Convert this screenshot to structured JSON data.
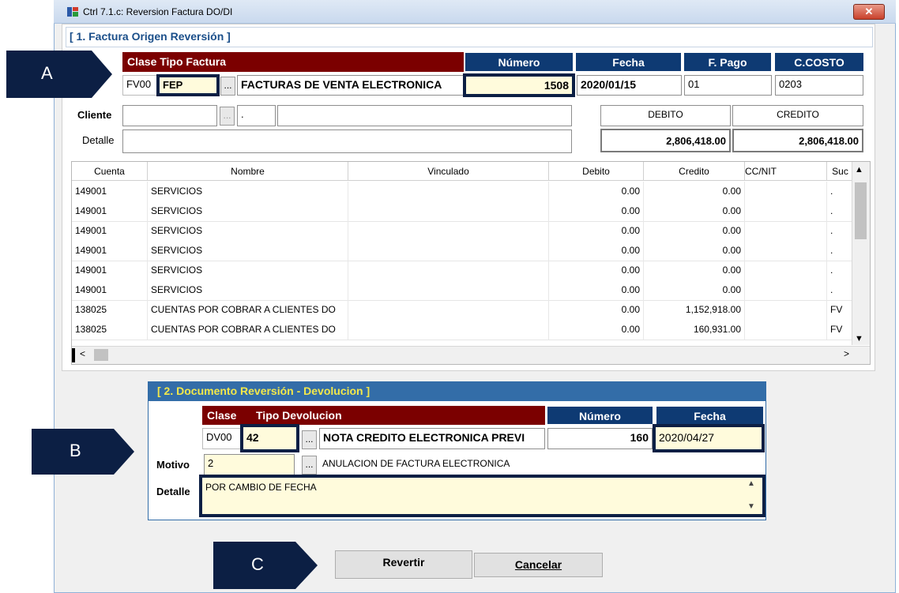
{
  "window": {
    "title": "Ctrl 7.1.c:  Reversion Factura DO/DI",
    "close_label": "✕"
  },
  "section1": {
    "title": "[ 1. Factura Origen Reversión ]",
    "headers": {
      "clase_tipo": "Clase  Tipo Factura",
      "numero": "Número",
      "fecha": "Fecha",
      "f_pago": "F. Pago",
      "c_costo": "C.COSTO"
    },
    "clase": "FV00",
    "tipo": "FEP",
    "dots": "...",
    "tipo_nombre": "FACTURAS DE VENTA ELECTRONICA",
    "numero": "1508",
    "fecha": "2020/01/15",
    "f_pago": "01",
    "c_costo": "0203",
    "cliente_label": "Cliente",
    "cliente_extra": ".",
    "detalle_label": "Detalle",
    "debito_label": "DEBITO",
    "credito_label": "CREDITO",
    "debito_total": "2,806,418.00",
    "credito_total": "2,806,418.00"
  },
  "grid": {
    "columns": {
      "cuenta": "Cuenta",
      "nombre": "Nombre",
      "vinculado": "Vinculado",
      "debito": "Debito",
      "credito": "Credito",
      "ccnit": "CC/NIT",
      "suc": "Suc"
    },
    "rows": [
      {
        "cuenta": "149001",
        "nombre": "SERVICIOS",
        "debito": "0.00",
        "credito": "0.00",
        "suc": "."
      },
      {
        "cuenta": "149001",
        "nombre": "SERVICIOS",
        "debito": "0.00",
        "credito": "0.00",
        "suc": "."
      },
      {
        "cuenta": "149001",
        "nombre": "SERVICIOS",
        "debito": "0.00",
        "credito": "0.00",
        "suc": "."
      },
      {
        "cuenta": "149001",
        "nombre": "SERVICIOS",
        "debito": "0.00",
        "credito": "0.00",
        "suc": "."
      },
      {
        "cuenta": "149001",
        "nombre": "SERVICIOS",
        "debito": "0.00",
        "credito": "0.00",
        "suc": "."
      },
      {
        "cuenta": "149001",
        "nombre": "SERVICIOS",
        "debito": "0.00",
        "credito": "0.00",
        "suc": "."
      },
      {
        "cuenta": "138025",
        "nombre": "CUENTAS POR COBRAR A CLIENTES DO",
        "debito": "0.00",
        "credito": "1,152,918.00",
        "suc": "FV"
      },
      {
        "cuenta": "138025",
        "nombre": "CUENTAS POR COBRAR A CLIENTES DO",
        "debito": "0.00",
        "credito": "160,931.00",
        "suc": "FV"
      }
    ]
  },
  "section2": {
    "title": "[ 2. Documento Reversión - Devolucion ]",
    "headers": {
      "clase": "Clase",
      "tipo": "Tipo Devolucion",
      "numero": "Número",
      "fecha": "Fecha"
    },
    "clase": "DV00",
    "tipo": "42",
    "dots": "...",
    "tipo_nombre": "NOTA CREDITO ELECTRONICA PREVI",
    "numero": "160",
    "fecha": "2020/04/27",
    "motivo_label": "Motivo",
    "motivo": "2",
    "motivo_nombre": "ANULACION DE FACTURA ELECTRONICA",
    "detalle_label": "Detalle",
    "detalle": "POR CAMBIO DE FECHA"
  },
  "buttons": {
    "revertir": "Revertir",
    "cancelar": "Cancelar"
  },
  "callouts": {
    "a": "A",
    "b": "B",
    "c": "C"
  }
}
